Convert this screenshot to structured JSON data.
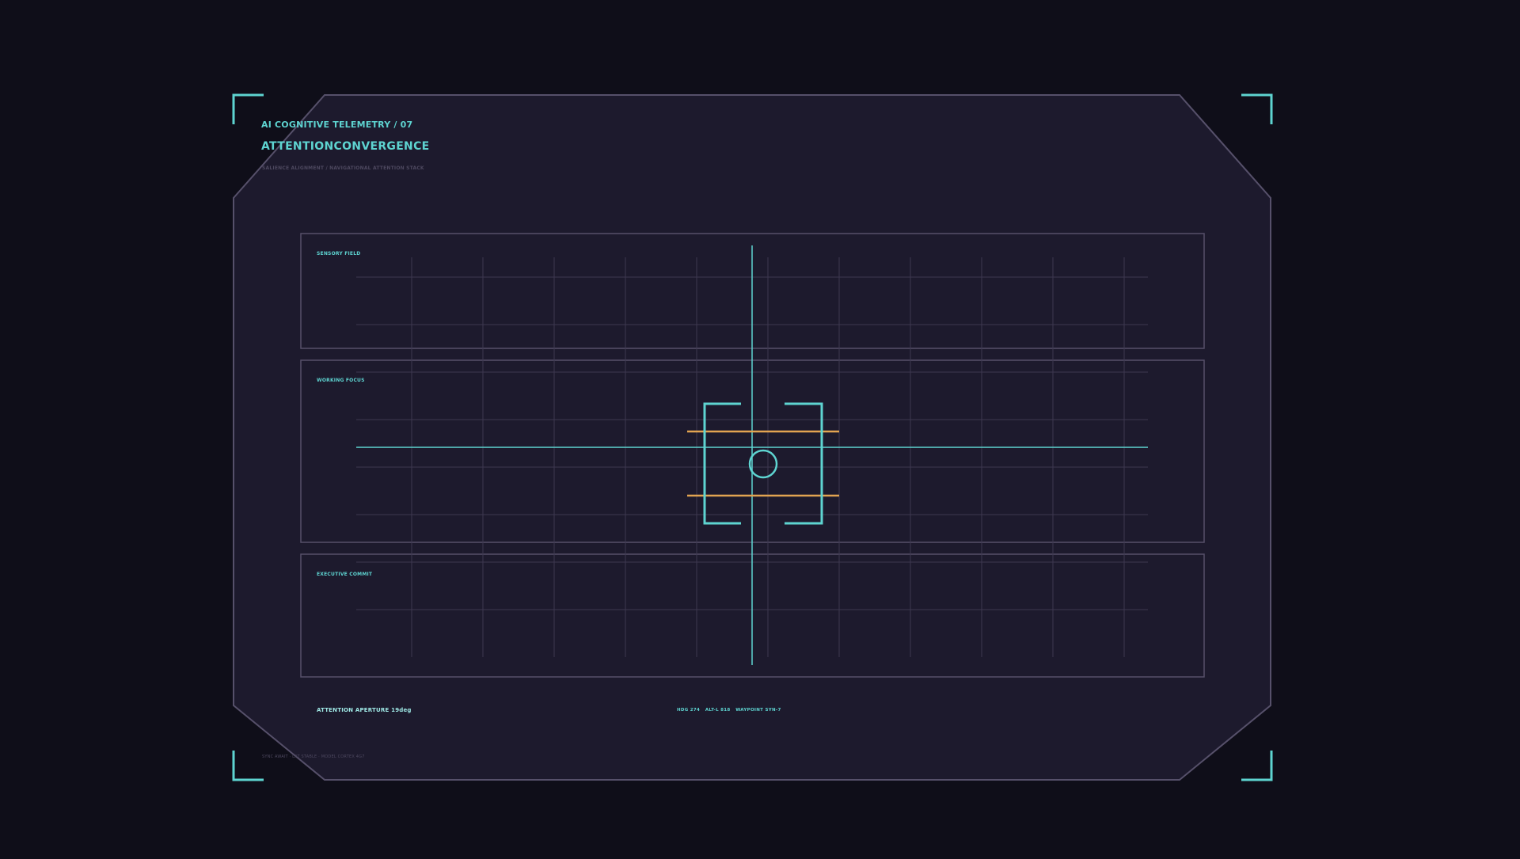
{
  "header": {
    "kicker": "AI COGNITIVE TELEMETRY / 07",
    "title": "ATTENTIONCONVERGENCE",
    "subtitle": "SALIENCE ALIGNMENT / NAVIGATIONAL ATTENTION STACK"
  },
  "lanes": [
    {
      "label": "SENSORY FIELD"
    },
    {
      "label": "WORKING FOCUS"
    },
    {
      "label": "EXECUTIVE COMMIT"
    }
  ],
  "readouts": {
    "aperture": "ATTENTION APERTURE 19deg",
    "heading": "HDG 274",
    "altitude": "ALT-L 818",
    "waypoint": "WAYPOINT SYN-7"
  },
  "footer": {
    "note": "SYNC AWAIT · LAT STABLE · MODEL CORTEX 4G7"
  },
  "colors": {
    "background": "#0f0e19",
    "panel": "#1d1a2d",
    "panel_border": "#56506a",
    "accent_cyan": "#5ed4d1",
    "accent_amber": "#e2a451",
    "grid": "#3d3850",
    "subtle_text": "#5a546c"
  },
  "icons": {
    "corner_brackets": "corner-bracket-icon",
    "reticle": "focus-reticle-icon"
  }
}
